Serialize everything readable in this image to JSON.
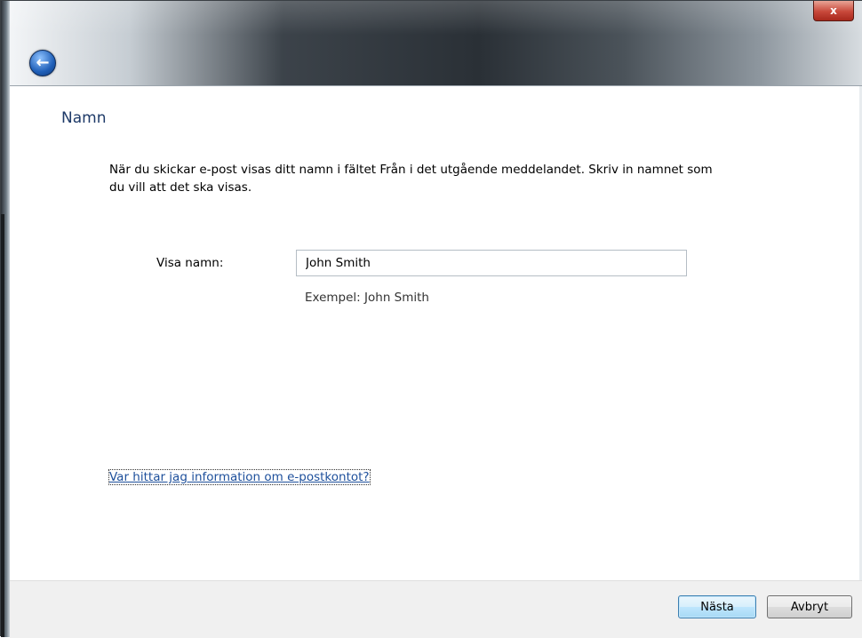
{
  "window": {
    "close_glyph": "x"
  },
  "header": {
    "back_icon": "back-arrow-icon",
    "back_glyph": "←"
  },
  "page": {
    "title": "Namn",
    "description": "När du skickar e-post visas ditt namn i fältet Från i det utgående meddelandet. Skriv in namnet som du vill att det ska visas."
  },
  "form": {
    "display_name_label": "Visa namn:",
    "display_name_value": "John Smith",
    "example": "Exempel: John Smith"
  },
  "help": {
    "link_text": "Var hittar jag information om e-postkontot?"
  },
  "footer": {
    "next_label": "Nästa",
    "cancel_label": "Avbryt"
  },
  "colors": {
    "title": "#1e3a68",
    "link": "#1d4f9b",
    "footer_bg": "#f0f0f0"
  }
}
